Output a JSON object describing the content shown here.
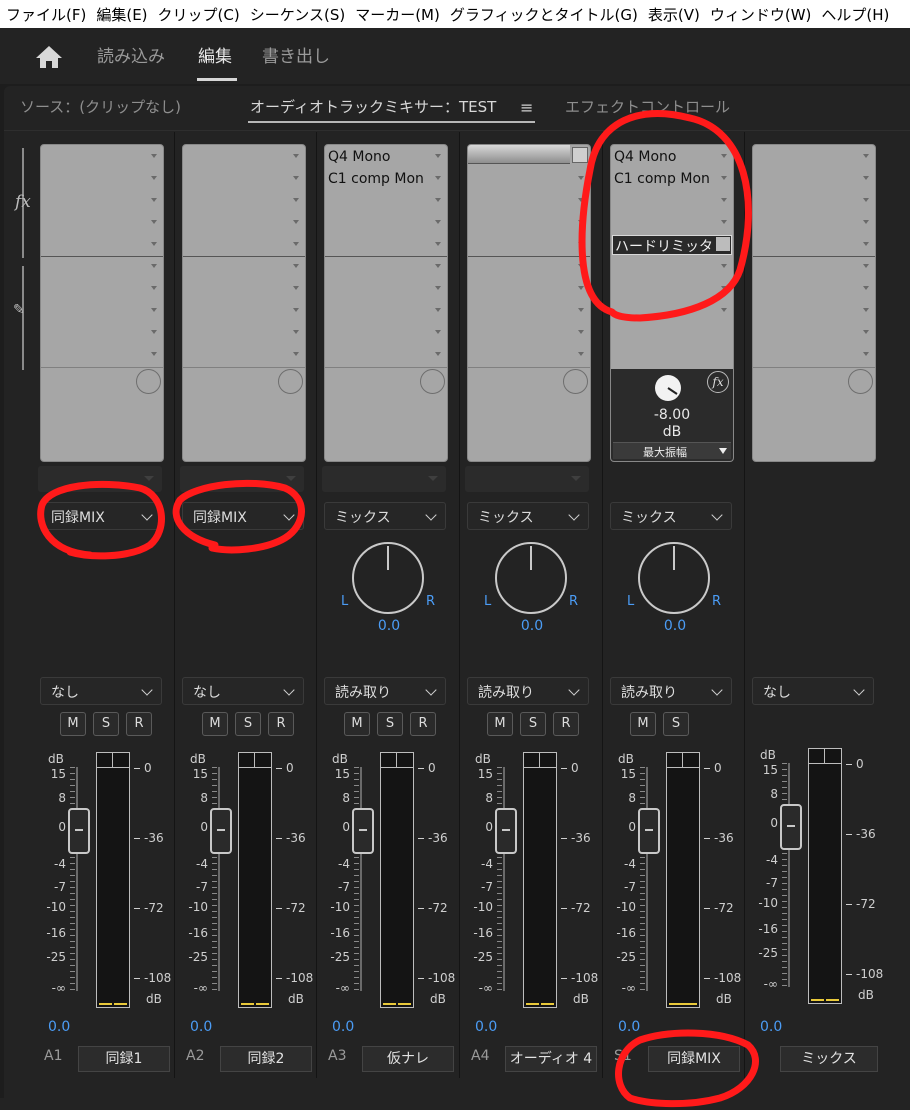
{
  "menu": [
    "ファイル(F)",
    "編集(E)",
    "クリップ(C)",
    "シーケンス(S)",
    "マーカー(M)",
    "グラフィックとタイトル(G)",
    "表示(V)",
    "ウィンドウ(W)",
    "ヘルプ(H)"
  ],
  "workspace": {
    "tabs": [
      "読み込み",
      "編集",
      "書き出し"
    ],
    "active": "編集"
  },
  "panel_tabs": {
    "source": "ソース：(クリップなし)",
    "mixer": "オーディオトラックミキサー：TEST",
    "effects": "エフェクトコントロール"
  },
  "channels": [
    {
      "id": "A1",
      "fx": [
        "",
        ""
      ],
      "route": "同録MIX",
      "pan": null,
      "auto": "なし",
      "buttons": [
        "M",
        "S",
        "R"
      ],
      "volume": "0.0",
      "name": "同録1"
    },
    {
      "id": "A2",
      "fx": [
        "",
        ""
      ],
      "route": "同録MIX",
      "pan": null,
      "auto": "なし",
      "buttons": [
        "M",
        "S",
        "R"
      ],
      "volume": "0.0",
      "name": "同録2"
    },
    {
      "id": "A3",
      "fx": [
        "Q4 Mono",
        "C1 comp Mon"
      ],
      "route": "ミックス",
      "pan": "0.0",
      "auto": "読み取り",
      "buttons": [
        "M",
        "S",
        "R"
      ],
      "volume": "0.0",
      "name": "仮ナレ"
    },
    {
      "id": "A4",
      "fx": [
        "",
        ""
      ],
      "route": "ミックス",
      "pan": "0.0",
      "auto": "読み取り",
      "buttons": [
        "M",
        "S",
        "R"
      ],
      "volume": "0.0",
      "name": "オーディオ 4"
    },
    {
      "id": "S1",
      "fx": [
        "Q4 Mono",
        "C1 comp Mon"
      ],
      "route": "ミックス",
      "pan": "0.0",
      "auto": "読み取り",
      "buttons": [
        "M",
        "S"
      ],
      "volume": "0.0",
      "name": "同録MIX",
      "insert": "ハードリミッタ",
      "param": {
        "value": "-8.00",
        "unit": "dB",
        "label": "最大振幅"
      }
    },
    {
      "id": "",
      "fx": [
        "",
        ""
      ],
      "route": null,
      "pan": null,
      "auto": "なし",
      "buttons": [],
      "volume": "0.0",
      "name": "ミックス"
    }
  ],
  "fader_scale": {
    "unit": "dB",
    "ticks": [
      "15",
      "8",
      "0",
      "-4",
      "-7",
      "-10",
      "-16",
      "-25",
      "-∞"
    ]
  },
  "meter_scale": {
    "ticks": [
      "0",
      "-36",
      "-72",
      "-108"
    ],
    "unit": "dB"
  },
  "colors": {
    "accent_blue": "#4b9cf5",
    "meter_yellow": "#e9c93a",
    "annotation_red": "#ff1a1a"
  }
}
